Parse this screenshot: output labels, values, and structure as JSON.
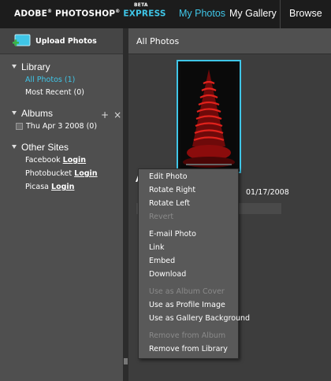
{
  "brand": {
    "adobe": "ADOBE",
    "photoshop": "PHOTOSHOP",
    "express": "EXPRESS",
    "beta": "BETA"
  },
  "nav": {
    "my_photos": "My Photos",
    "my_gallery": "My Gallery",
    "browse": "Browse"
  },
  "sidebar": {
    "upload": "Upload Photos",
    "library": {
      "title": "Library",
      "items": [
        "All Photos (1)",
        "Most Recent (0)"
      ]
    },
    "albums": {
      "title": "Albums",
      "add": "+",
      "remove": "×",
      "items": [
        "Thu Apr 3 2008 (0)"
      ]
    },
    "other_sites": {
      "title": "Other Sites",
      "items": [
        {
          "site": "Facebook",
          "action": "Login"
        },
        {
          "site": "Photobucket",
          "action": "Login"
        },
        {
          "site": "Picasa",
          "action": "Login"
        }
      ]
    }
  },
  "main": {
    "title": "All Photos",
    "photo_date": "01/17/2008",
    "peek_letter": "A"
  },
  "context_menu": {
    "items": [
      {
        "label": "Edit Photo",
        "enabled": true
      },
      {
        "label": "Rotate Right",
        "enabled": true
      },
      {
        "label": "Rotate Left",
        "enabled": true
      },
      {
        "label": "Revert",
        "enabled": false
      },
      {
        "label": "E-mail Photo",
        "enabled": true
      },
      {
        "label": "Link",
        "enabled": true
      },
      {
        "label": "Embed",
        "enabled": true
      },
      {
        "label": "Download",
        "enabled": true
      },
      {
        "label": "Use as Album Cover",
        "enabled": false
      },
      {
        "label": "Use as Profile Image",
        "enabled": true
      },
      {
        "label": "Use as Gallery Background",
        "enabled": true
      },
      {
        "label": "Remove from Album",
        "enabled": false
      },
      {
        "label": "Remove from Library",
        "enabled": true
      }
    ]
  },
  "colors": {
    "accent": "#3fc6e8",
    "topbar": "#1c1c1c",
    "sidebar": "#4f4f4f",
    "menu": "#595959",
    "upload_green": "#3bb44a"
  }
}
